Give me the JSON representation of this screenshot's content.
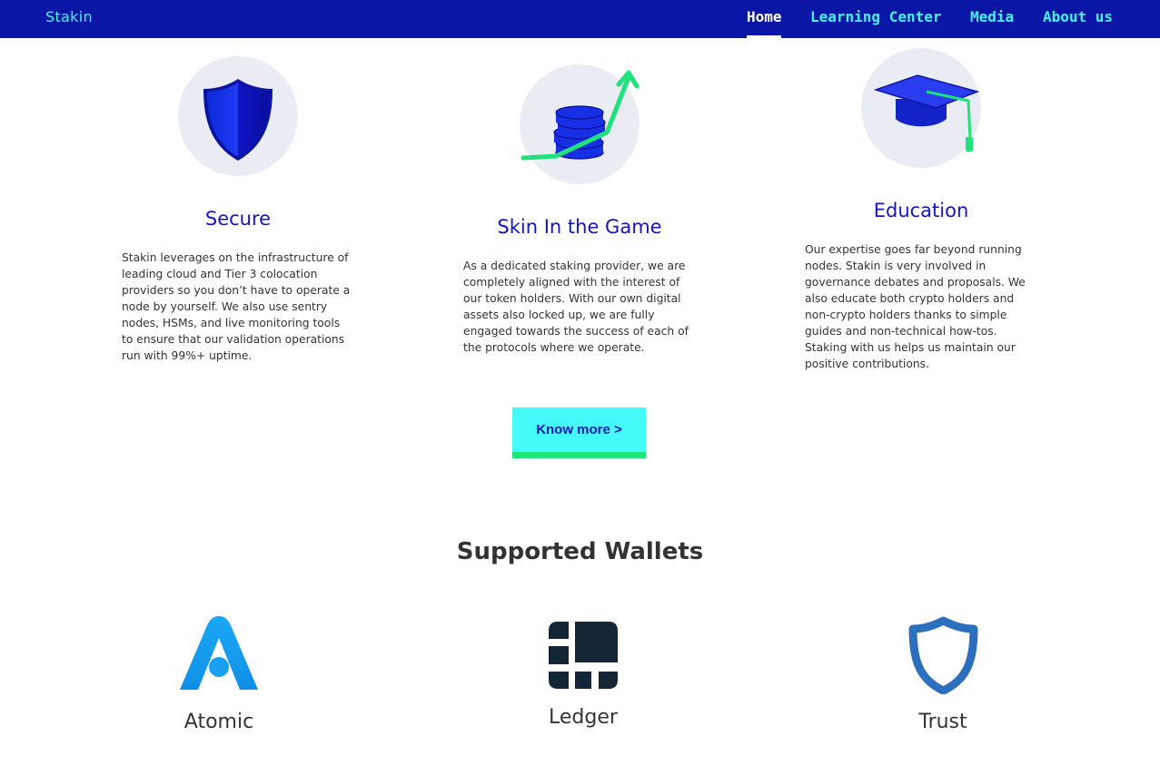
{
  "nav": {
    "brand": "Stakin",
    "items": [
      {
        "label": "Home",
        "active": true
      },
      {
        "label": "Learning Center"
      },
      {
        "label": "Media"
      },
      {
        "label": "About us"
      }
    ]
  },
  "features": [
    {
      "icon": "shield-icon",
      "title": "Secure",
      "description": "Stakin leverages on the infrastructure of leading cloud and Tier 3 colocation providers so you don’t have to operate a node by yourself. We also use sentry nodes, HSMs, and live monitoring tools to ensure that our validation operations run with 99%+ uptime."
    },
    {
      "icon": "coins-growth-icon",
      "title": "Skin In the Game",
      "description": "As a dedicated staking provider, we are completely aligned with the interest of our token holders. With our own digital assets also locked up, we are fully engaged towards the success of each of the protocols where we operate."
    },
    {
      "icon": "graduation-cap-icon",
      "title": "Education",
      "description": "Our expertise goes far beyond running nodes. Stakin is very involved in governance debates and proposals. We also educate both crypto holders and non-crypto holders thanks to simple guides and non-technical how-tos. Staking with us helps us maintain our positive contributions."
    }
  ],
  "know_more_label": "Know more >",
  "wallets_section": {
    "title": "Supported Wallets",
    "wallets": [
      {
        "icon": "atomic-logo-icon",
        "name": "Atomic"
      },
      {
        "icon": "ledger-logo-icon",
        "name": "Ledger"
      },
      {
        "icon": "trust-logo-icon",
        "name": "Trust"
      }
    ]
  },
  "colors": {
    "nav_bg": "#0a17a6",
    "nav_link": "#43f3f1",
    "accent_blue": "#1315c7",
    "button_bg": "#45fbfa",
    "button_border": "#1ee57a"
  }
}
